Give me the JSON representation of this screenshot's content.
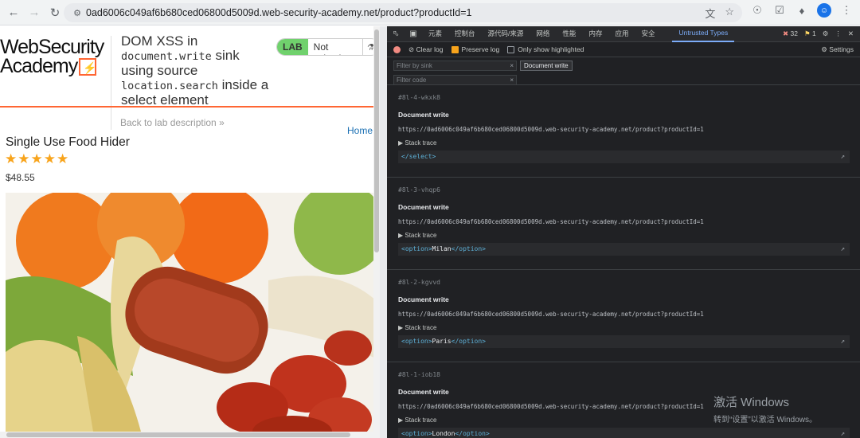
{
  "browser": {
    "url": "0ad6006c049af6b680ced06800d5009d.web-security-academy.net/product?productId=1",
    "icons": [
      "back-icon",
      "forward-icon",
      "reload-icon",
      "site-info-icon",
      "translate-icon",
      "bookmark-star-icon",
      "extension-icon",
      "puzzle-icon",
      "profile-icon",
      "more-icon"
    ],
    "avatar_letter": "☺"
  },
  "page": {
    "logo_line1": "WebSecurity",
    "logo_line2": "Academy",
    "lab_title_1": "DOM XSS in",
    "lab_title_code1": "document.write",
    "lab_title_2": " sink using source",
    "lab_title_code2": "location.search",
    "lab_title_3": " inside a select element",
    "lab_tag": "LAB",
    "lab_status": "Not solved",
    "back_link": "Back to lab description »",
    "home_link": "Home",
    "product_name": "Single Use Food Hider",
    "stars": "★★★★★",
    "price": "$48.55",
    "colors": {
      "accent": "#ff6633",
      "lab_green": "#70d16d",
      "link": "#1a6fb3",
      "star": "#f8a41c"
    }
  },
  "devtools": {
    "tabs": [
      "元素",
      "控制台",
      "源代码/来源",
      "网络",
      "性能",
      "内存",
      "应用",
      "安全",
      "Untrusted Types"
    ],
    "active_tab": "Untrusted Types",
    "error_count": "32",
    "warning_count": "1",
    "toolbar": {
      "clear_log": "Clear log",
      "preserve_log": "Preserve log",
      "only_highlighted": "Only show highlighted",
      "settings": "Settings"
    },
    "filters": {
      "sink_placeholder": "Filter by sink",
      "code_placeholder": "Filter code",
      "chip": "Document write"
    },
    "entries": [
      {
        "id": "#8l-4-wkxk8",
        "title": "Document write",
        "url": "https://0ad6006c049af6b680ced06800d5009d.web-security-academy.net/product?productId=1",
        "stack": "▶ Stack trace",
        "code_open": "",
        "code_text": "",
        "code_close": "</select>"
      },
      {
        "id": "#8l-3-vhqp6",
        "title": "Document write",
        "url": "https://0ad6006c049af6b680ced06800d5009d.web-security-academy.net/product?productId=1",
        "stack": "▶ Stack trace",
        "code_open": "<option>",
        "code_text": "Milan",
        "code_close": "</option>"
      },
      {
        "id": "#8l-2-kgvvd",
        "title": "Document write",
        "url": "https://0ad6006c049af6b680ced06800d5009d.web-security-academy.net/product?productId=1",
        "stack": "▶ Stack trace",
        "code_open": "<option>",
        "code_text": "Paris",
        "code_close": "</option>"
      },
      {
        "id": "#8l-1-iob18",
        "title": "Document write",
        "url": "https://0ad6006c049af6b680ced06800d5009d.web-security-academy.net/product?productId=1",
        "stack": "▶ Stack trace",
        "code_open": "<option>",
        "code_text": "London",
        "code_close": "</option>"
      }
    ]
  },
  "watermark": {
    "line1": "激活 Windows",
    "line2": "转到“设置”以激活 Windows。"
  }
}
